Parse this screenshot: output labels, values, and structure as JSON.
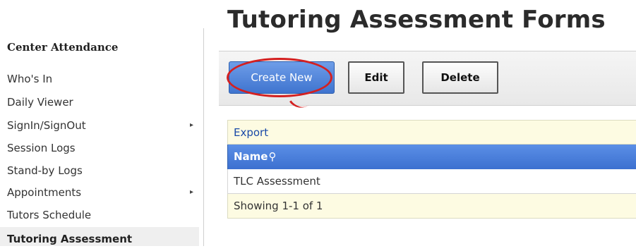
{
  "sidebar": {
    "section_title": "Center Attendance",
    "items": [
      {
        "label": "Who's In",
        "submenu": false
      },
      {
        "label": "Daily Viewer",
        "submenu": false
      },
      {
        "label": "SignIn/SignOut",
        "submenu": true
      },
      {
        "label": "Session Logs",
        "submenu": false
      },
      {
        "label": "Stand-by Logs",
        "submenu": false
      },
      {
        "label": "Appointments",
        "submenu": true
      },
      {
        "label": "Tutors Schedule",
        "submenu": false
      },
      {
        "label": "Tutoring Assessment",
        "submenu": false,
        "active": true
      }
    ],
    "submenu_arrow": "▸"
  },
  "page": {
    "title": "Tutoring Assessment Forms"
  },
  "toolbar": {
    "create_label": "Create New",
    "edit_label": "Edit",
    "delete_label": "Delete"
  },
  "grid": {
    "export_label": "Export",
    "columns": [
      "Name"
    ],
    "search_icon": "⚲",
    "rows": [
      [
        "TLC Assessment"
      ]
    ],
    "footer": "Showing 1-1 of 1"
  },
  "colors": {
    "accent_blue": "#3f74cf",
    "highlight_red": "#d42020",
    "row_yellow": "#fdfbe2"
  }
}
